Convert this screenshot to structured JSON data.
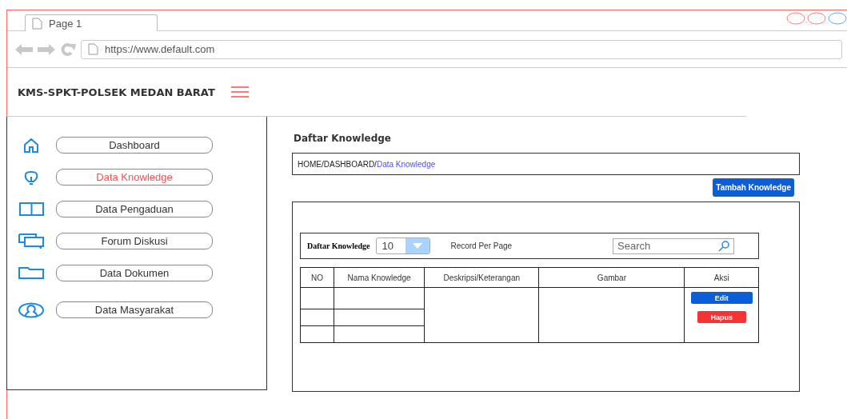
{
  "browser": {
    "tab": "Page 1",
    "url": "https://www.default.com"
  },
  "app_title": "KMS-SPKT-POLSEK MEDAN BARAT",
  "sidebar": {
    "items": [
      {
        "label": "Dashboard",
        "kind": "home",
        "selected": false
      },
      {
        "label": "Data Knowledge",
        "kind": "bulb",
        "selected": true
      },
      {
        "label": "Data Pengaduan",
        "kind": "book",
        "selected": false
      },
      {
        "label": "Forum Diskusi",
        "kind": "chat",
        "selected": false
      },
      {
        "label": "Data Dokumen",
        "kind": "folder",
        "selected": false
      },
      {
        "label": "Data Masyarakat",
        "kind": "user",
        "selected": false
      }
    ]
  },
  "page_title": "Daftar Knowledge",
  "breadcrumb": {
    "path": "HOME/DASHBOARD/",
    "current": "Data Knowledge"
  },
  "add_button": "Tambah Knowledge",
  "table_toolbar": {
    "label": "Daftar Knowledge",
    "page_size": "10",
    "page_size_label": "Record Per Page",
    "search": {
      "placeholder": "Search"
    }
  },
  "table": {
    "columns": [
      "NO",
      "Nama Knowledge",
      "Deskripsi/Keterangan",
      "Gambar",
      "Aksi"
    ],
    "actions": [
      {
        "label": "Edit",
        "color": "#0b5ed7"
      },
      {
        "label": "Hapus",
        "color": "#f53333"
      }
    ]
  }
}
